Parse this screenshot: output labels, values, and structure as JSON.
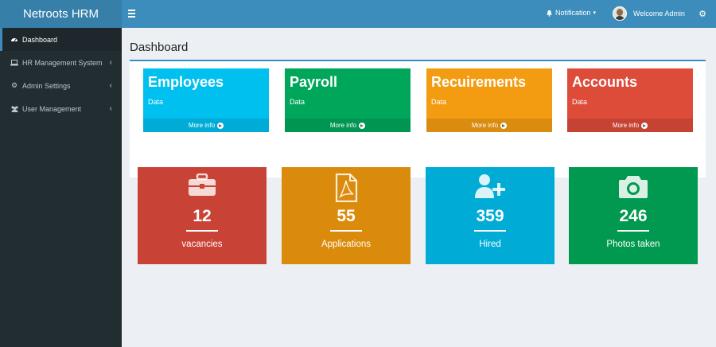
{
  "app": {
    "title": "Netroots HRM"
  },
  "header": {
    "notification_label": "Notification",
    "welcome": "Welcome Admin"
  },
  "sidebar": {
    "items": [
      {
        "label": "Dashboard",
        "icon": "dashboard-icon"
      },
      {
        "label": "HR Management System",
        "icon": "laptop-icon"
      },
      {
        "label": "Admin Settings",
        "icon": "gear-icon"
      },
      {
        "label": "User Management",
        "icon": "users-icon"
      }
    ]
  },
  "page": {
    "title": "Dashboard"
  },
  "tiles": [
    {
      "title": "Employees",
      "subtitle": "Data",
      "footer": "More info",
      "color": "#00c0ef"
    },
    {
      "title": "Payroll",
      "subtitle": "Data",
      "footer": "More info",
      "color": "#00a65a"
    },
    {
      "title": "Recuirements",
      "subtitle": "Data",
      "footer": "More info",
      "color": "#f39c12"
    },
    {
      "title": "Accounts",
      "subtitle": "Data",
      "footer": "More info",
      "color": "#dd4b39"
    }
  ],
  "stats": [
    {
      "value": "12",
      "label": "vacancies",
      "icon": "briefcase-icon",
      "color": "#c94236"
    },
    {
      "value": "55",
      "label": "Applications",
      "icon": "pdf-file-icon",
      "color": "#db8b0b"
    },
    {
      "value": "359",
      "label": "Hired",
      "icon": "user-plus-icon",
      "color": "#00acd6"
    },
    {
      "value": "246",
      "label": "Photos taken",
      "icon": "camera-icon",
      "color": "#00994f"
    }
  ]
}
